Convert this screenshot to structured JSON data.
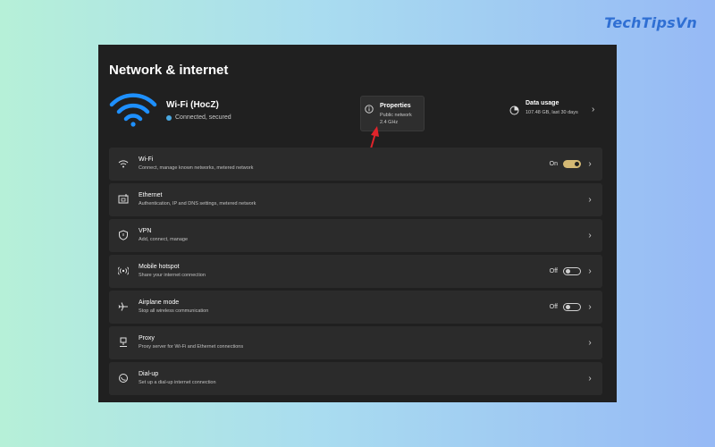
{
  "watermark": "TechTipsVn",
  "page": {
    "title": "Network & internet"
  },
  "connection": {
    "ssid": "Wi-Fi (HocZ)",
    "status": "Connected, secured"
  },
  "properties": {
    "title": "Properties",
    "network_type": "Public network",
    "band": "2.4 GHz"
  },
  "data_usage": {
    "title": "Data usage",
    "detail": "107.48 GB, last 30 days"
  },
  "rows": [
    {
      "title": "Wi-Fi",
      "subtitle": "Connect, manage known networks, metered network",
      "icon": "wifi-icon",
      "toggle_label": "On",
      "toggle_state": "on"
    },
    {
      "title": "Ethernet",
      "subtitle": "Authentication, IP and DNS settings, metered network",
      "icon": "ethernet-icon"
    },
    {
      "title": "VPN",
      "subtitle": "Add, connect, manage",
      "icon": "shield-icon"
    },
    {
      "title": "Mobile hotspot",
      "subtitle": "Share your internet connection",
      "icon": "hotspot-icon",
      "toggle_label": "Off",
      "toggle_state": "off"
    },
    {
      "title": "Airplane mode",
      "subtitle": "Stop all wireless communication",
      "icon": "airplane-icon",
      "toggle_label": "Off",
      "toggle_state": "off"
    },
    {
      "title": "Proxy",
      "subtitle": "Proxy server for Wi-Fi and Ethernet connections",
      "icon": "proxy-icon"
    },
    {
      "title": "Dial-up",
      "subtitle": "Set up a dial-up internet connection",
      "icon": "dialup-icon"
    }
  ],
  "colors": {
    "window_bg": "#202020",
    "row_bg": "#2b2b2b",
    "toggle_on": "#d3b873",
    "wifi_blue": "#1e90ff",
    "annotation_arrow": "#e0242b",
    "watermark": "#2f6fd3"
  }
}
